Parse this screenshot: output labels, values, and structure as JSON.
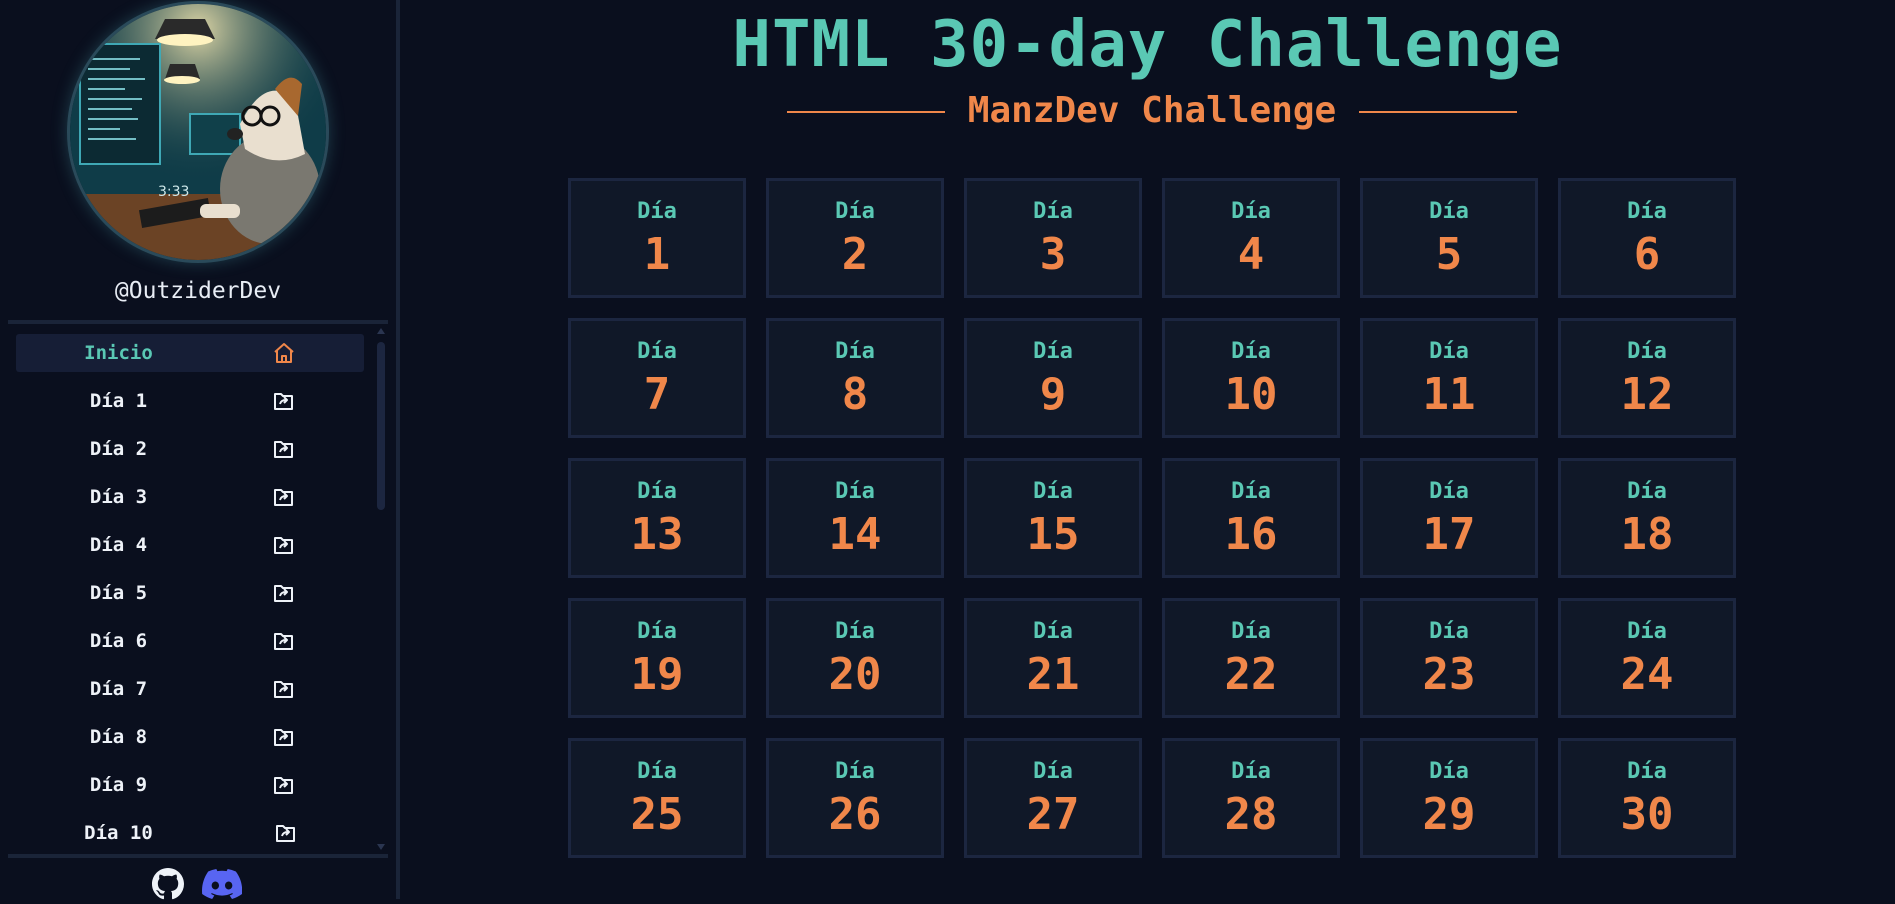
{
  "profile": {
    "username": "@OutziderDev",
    "avatar_icon": "dog-coder-avatar"
  },
  "nav": {
    "items": [
      {
        "label": "Inicio",
        "icon": "home-icon",
        "active": true
      },
      {
        "label": "Día 1",
        "icon": "folder-arrow-icon"
      },
      {
        "label": "Día 2",
        "icon": "folder-arrow-icon"
      },
      {
        "label": "Día 3",
        "icon": "folder-arrow-icon"
      },
      {
        "label": "Día 4",
        "icon": "folder-arrow-icon"
      },
      {
        "label": "Día 5",
        "icon": "folder-arrow-icon"
      },
      {
        "label": "Día 6",
        "icon": "folder-arrow-icon"
      },
      {
        "label": "Día 7",
        "icon": "folder-arrow-icon"
      },
      {
        "label": "Día 8",
        "icon": "folder-arrow-icon"
      },
      {
        "label": "Día 9",
        "icon": "folder-arrow-icon"
      },
      {
        "label": "Día 10",
        "icon": "folder-arrow-icon"
      }
    ]
  },
  "social": {
    "github": "github-icon",
    "discord": "discord-icon"
  },
  "header": {
    "title": "HTML 30-day Challenge",
    "subtitle": "ManzDev Challenge"
  },
  "days": {
    "label": "Día",
    "numbers": [
      "1",
      "2",
      "3",
      "4",
      "5",
      "6",
      "7",
      "8",
      "9",
      "10",
      "11",
      "12",
      "13",
      "14",
      "15",
      "16",
      "17",
      "18",
      "19",
      "20",
      "21",
      "22",
      "23",
      "24",
      "25",
      "26",
      "27",
      "28",
      "29",
      "30"
    ]
  },
  "colors": {
    "teal": "#5ac8b4",
    "orange": "#f0874a",
    "background": "#0a0f1e",
    "card": "#101828"
  }
}
